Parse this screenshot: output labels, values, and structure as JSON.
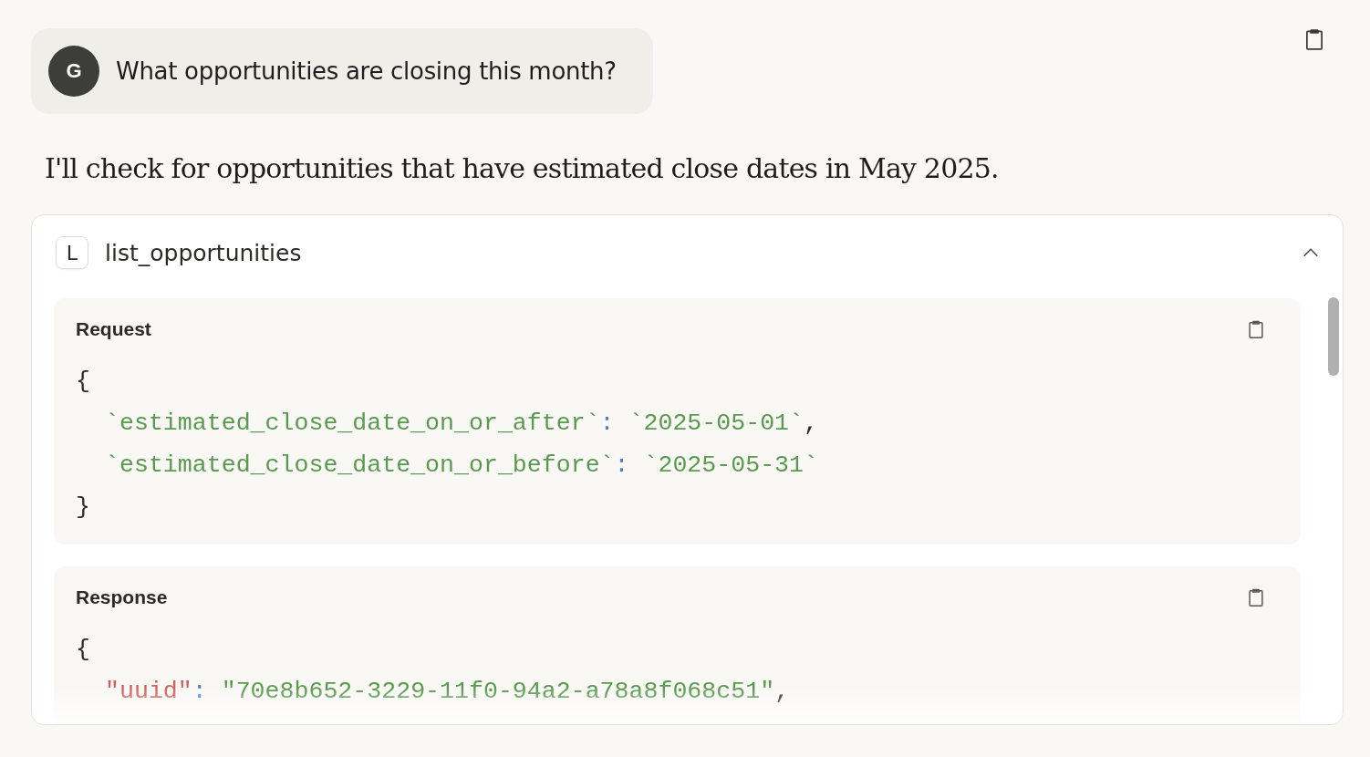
{
  "user_message": {
    "avatar": "G",
    "text": "What opportunities are closing this month?"
  },
  "assistant_text": "I'll check for opportunities that have estimated close dates in May 2025.",
  "tool_call": {
    "badge": "L",
    "name": "list_opportunities",
    "expanded": true,
    "sections": [
      {
        "title": "Request",
        "lines": [
          [
            {
              "kind": "plain",
              "text": "{"
            }
          ],
          [
            {
              "kind": "string",
              "text": "`estimated_close_date_on_or_after`"
            },
            {
              "kind": "colon",
              "text": ":"
            },
            {
              "kind": "string",
              "text": "`2025-05-01`"
            },
            {
              "kind": "plain",
              "text": ","
            }
          ],
          [
            {
              "kind": "string",
              "text": "`estimated_close_date_on_or_before`"
            },
            {
              "kind": "colon",
              "text": ":"
            },
            {
              "kind": "string",
              "text": "`2025-05-31`"
            }
          ],
          [
            {
              "kind": "plain",
              "text": "}"
            }
          ]
        ]
      },
      {
        "title": "Response",
        "lines": [
          [
            {
              "kind": "plain",
              "text": "{"
            }
          ],
          [
            {
              "kind": "key",
              "text": "\"uuid\""
            },
            {
              "kind": "colon",
              "text": ":"
            },
            {
              "kind": "string",
              "text": "\"70e8b652-3229-11f0-94a2-a78a8f068c51\""
            },
            {
              "kind": "plain",
              "text": ","
            }
          ]
        ]
      }
    ]
  }
}
